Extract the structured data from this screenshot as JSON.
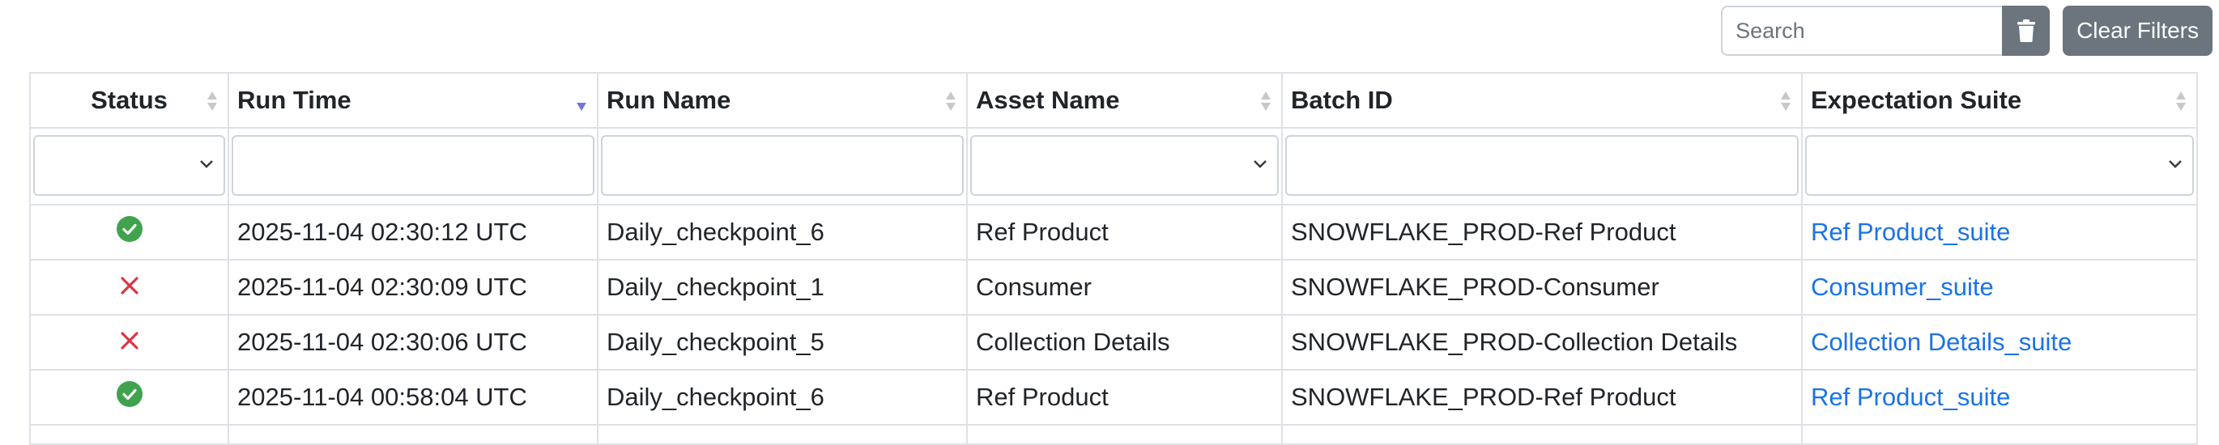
{
  "toolbar": {
    "search_placeholder": "Search",
    "trash_icon": "trash-icon",
    "clear_filters_label": "Clear Filters"
  },
  "columns": [
    {
      "label": "Status",
      "sort": "none",
      "filter": "select"
    },
    {
      "label": "Run Time",
      "sort": "descending",
      "filter": "text"
    },
    {
      "label": "Run Name",
      "sort": "none",
      "filter": "text"
    },
    {
      "label": "Asset Name",
      "sort": "none",
      "filter": "select"
    },
    {
      "label": "Batch ID",
      "sort": "none",
      "filter": "text"
    },
    {
      "label": "Expectation Suite",
      "sort": "none",
      "filter": "select"
    }
  ],
  "rows": [
    {
      "status": "success",
      "run_time": "2025-11-04 02:30:12 UTC",
      "run_name": "Daily_checkpoint_6",
      "asset_name": "Ref Product",
      "batch_id": "SNOWFLAKE_PROD-Ref Product",
      "suite": "Ref Product_suite"
    },
    {
      "status": "failure",
      "run_time": "2025-11-04 02:30:09 UTC",
      "run_name": "Daily_checkpoint_1",
      "asset_name": "Consumer",
      "batch_id": "SNOWFLAKE_PROD-Consumer",
      "suite": "Consumer_suite"
    },
    {
      "status": "failure",
      "run_time": "2025-11-04 02:30:06 UTC",
      "run_name": "Daily_checkpoint_5",
      "asset_name": "Collection Details",
      "batch_id": "SNOWFLAKE_PROD-Collection Details",
      "suite": "Collection Details_suite"
    },
    {
      "status": "success",
      "run_time": "2025-11-04 00:58:04 UTC",
      "run_name": "Daily_checkpoint_6",
      "asset_name": "Ref Product",
      "batch_id": "SNOWFLAKE_PROD-Ref Product",
      "suite": "Ref Product_suite"
    }
  ],
  "colors": {
    "success": "#3fa34d",
    "failure": "#dc3545",
    "link": "#1a73e8",
    "button": "#6c757d",
    "sort_active": "#6f78d8",
    "sort_inactive": "#c8c8c8"
  }
}
